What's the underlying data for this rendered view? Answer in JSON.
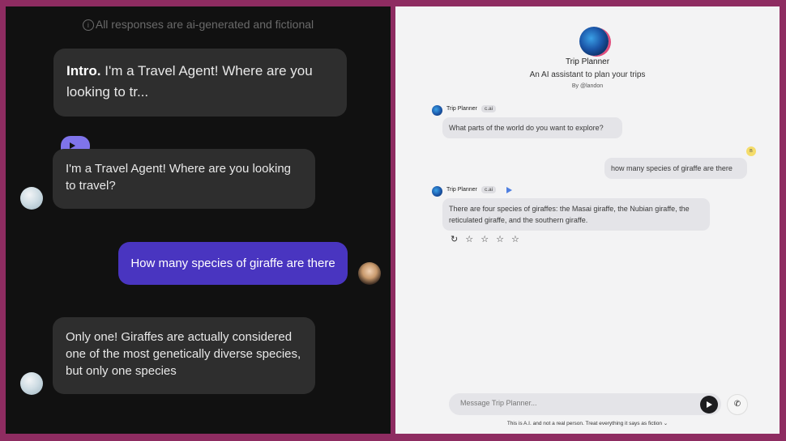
{
  "colors": {
    "frame": "#8e2c61",
    "left_bg": "#111111",
    "user_bubble": "#4935c0",
    "play_tag": "#7f74ea"
  },
  "left": {
    "disclaimer": "All responses are ai-generated and fictional",
    "intro_label": "Intro.",
    "intro_text": " I'm a Travel Agent! Where are you looking to tr...",
    "messages": [
      {
        "role": "bot",
        "text": "I'm a Travel Agent! Where are you looking to travel?"
      },
      {
        "role": "user",
        "text": "How many species of giraffe are there"
      },
      {
        "role": "bot",
        "text": "Only one! Giraffes are actually considered one of the most genetically diverse species, but only one species"
      }
    ]
  },
  "right": {
    "bot_name": "Trip Planner",
    "bot_description": "An AI assistant to plan your trips",
    "bot_author": "By @landon",
    "badge": "c.ai",
    "user_initial": "B",
    "messages": [
      {
        "role": "bot",
        "text": "What parts of the world do you want to explore?"
      },
      {
        "role": "user",
        "text": "how many species of giraffe are there"
      },
      {
        "role": "bot",
        "text": "There are four species of giraffes: the Masai giraffe, the Nubian giraffe, the reticulated giraffe, and the southern giraffe."
      }
    ],
    "actions": "↻ ☆ ☆ ☆ ☆",
    "input_placeholder": "Message Trip Planner...",
    "footer": "This is A.I. and not a real person. Treat everything it says as fiction ⌄"
  }
}
